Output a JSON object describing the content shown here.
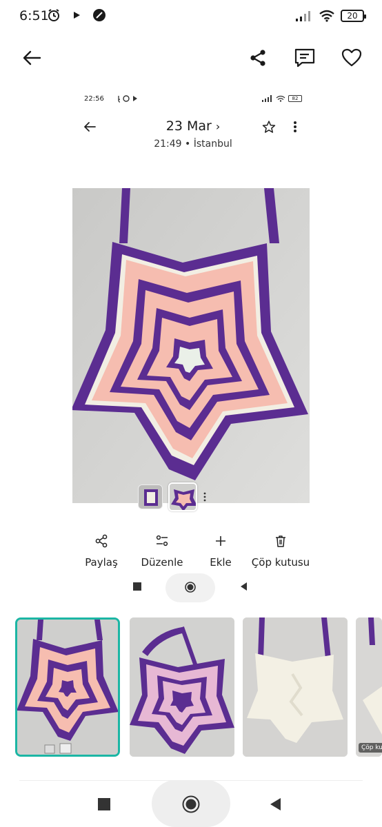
{
  "status_bar": {
    "time": "6:51",
    "battery": "20"
  },
  "inner_screenshot": {
    "status_time": "22:56",
    "battery": "82",
    "date_title": "23 Mar",
    "date_chevron": "›",
    "subtitle": "21:49 • İstanbul",
    "actions": [
      {
        "label": "Paylaş",
        "icon": "share-icon"
      },
      {
        "label": "Düzenle",
        "icon": "edit-sliders-icon"
      },
      {
        "label": "Ekle",
        "icon": "plus-icon"
      },
      {
        "label": "Çöp kutusu",
        "icon": "trash-icon"
      }
    ]
  },
  "gallery": {
    "selected_index": 0,
    "thumbnail_badge": "Çöp kut"
  },
  "colors": {
    "accent_teal": "#1bb6a4",
    "purple": "#5b2d91",
    "pink": "#f6bdb0",
    "cream": "#f2eee3"
  }
}
